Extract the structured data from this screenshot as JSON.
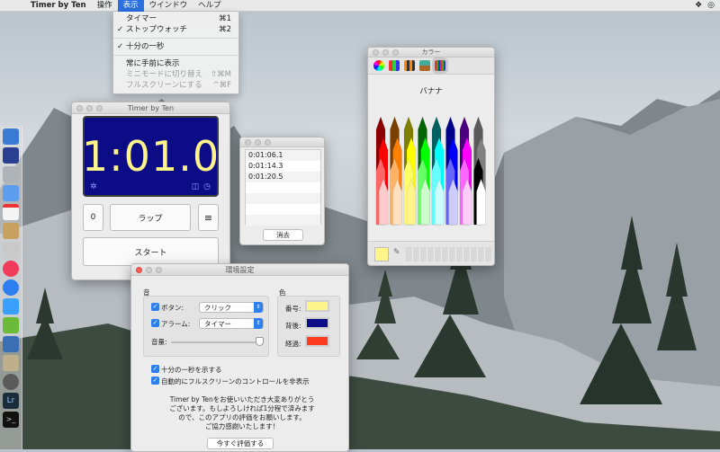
{
  "menubar": {
    "app_name": "Timer by Ten",
    "items": [
      "操作",
      "表示",
      "ウインドウ",
      "ヘルプ"
    ],
    "active_index": 1
  },
  "view_menu": {
    "items": [
      {
        "label": "タイマー",
        "shortcut": "⌘1",
        "checked": false,
        "disabled": false
      },
      {
        "label": "ストップウォッチ",
        "shortcut": "⌘2",
        "checked": true,
        "disabled": false
      },
      {
        "label": "十分の一秒",
        "shortcut": "",
        "checked": true,
        "disabled": false
      },
      {
        "label": "常に手前に表示",
        "shortcut": "",
        "checked": false,
        "disabled": false
      },
      {
        "label": "ミニモードに切り替え",
        "shortcut": "⇧⌘M",
        "checked": false,
        "disabled": true
      },
      {
        "label": "フルスクリーンにする",
        "shortcut": "^⌘F",
        "checked": false,
        "disabled": true
      }
    ]
  },
  "timer_window": {
    "title": "Timer by Ten",
    "display": "1:01.0",
    "count": "0",
    "lap_label": "ラップ",
    "start_label": "スタート",
    "menu_glyph": "≡"
  },
  "laps_window": {
    "laps": [
      "0:01:06.1",
      "0:01:14.3",
      "0:01:20.5"
    ],
    "clear_label": "消去"
  },
  "colors_window": {
    "title": "カラー",
    "selected_name": "バナナ"
  },
  "prefs_window": {
    "title": "環境設定",
    "sound_header": "音",
    "color_header": "色",
    "button_label": "ボタン:",
    "button_value": "クリック",
    "alarm_label": "アラーム:",
    "alarm_value": "タイマー",
    "volume_label": "音量:",
    "digits_label": "番号:",
    "back_label": "背後:",
    "elapsed_label": "経過:",
    "show_tenths": "十分の一秒を示する",
    "hide_controls": "自動的にフルスクリーンのコントロールを非表示",
    "thanks_lines": [
      "Timer by Tenをお使いいただき大変ありがとう",
      "ございます。もしよろしければ1分程で済みます",
      "ので、このアプリの評価をお願いします。",
      "ご協力感謝いたします！"
    ],
    "rate_button": "今すぐ評価する",
    "colors": {
      "digits": "#fff48a",
      "background": "#0b0c86",
      "elapsed": "#ff3b1f"
    }
  }
}
